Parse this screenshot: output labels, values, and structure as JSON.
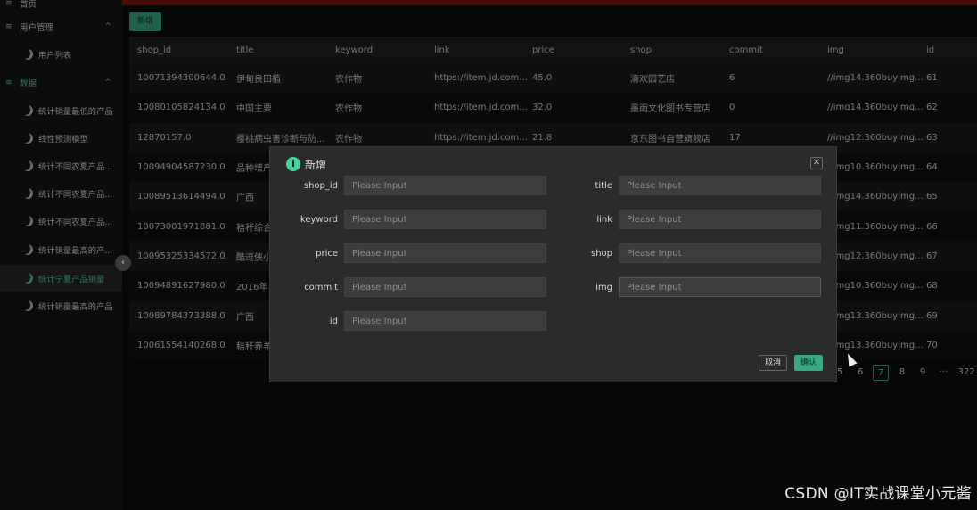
{
  "sidebar": {
    "top_partial_label": "首页",
    "groups": [
      {
        "label": "用户管理",
        "chevron": "^"
      },
      {
        "label": "数据",
        "chevron": "^"
      }
    ],
    "items": [
      {
        "label": "用户列表",
        "active": false
      },
      {
        "label": "统计销量最低的产品",
        "active": false
      },
      {
        "label": "线性预测模型",
        "active": false
      },
      {
        "label": "统计不同农夏产品...",
        "active": false
      },
      {
        "label": "统计不同农夏产品...",
        "active": false
      },
      {
        "label": "统计不同农夏产品...",
        "active": false
      },
      {
        "label": "统计销量最高的产...",
        "active": false
      },
      {
        "label": "统计宁夏产品销量",
        "active": true
      },
      {
        "label": "统计销量最高的产品",
        "active": false
      }
    ],
    "collapse_glyph": "‹"
  },
  "toolbar": {
    "add_label": "新增"
  },
  "table": {
    "columns": [
      "shop_id",
      "title",
      "keyword",
      "link",
      "price",
      "shop",
      "commit",
      "img",
      "id"
    ],
    "rows": [
      [
        "10071394300644.0",
        "伊甸良田植",
        "农作物",
        "https://item.jd.com...",
        "45.0",
        "清欢园艺店",
        "6",
        "//img14.360buyimg...",
        "61"
      ],
      [
        "10080105824134.0",
        "中国主要",
        "农作物",
        "https://item.jd.com...",
        "32.0",
        "墨雨文化图书专营店",
        "0",
        "//img14.360buyimg...",
        "62"
      ],
      [
        "12870157.0",
        "樱桃病虫害诊断与防...",
        "农作物",
        "https://item.jd.com...",
        "21.8",
        "京东图书自营旗舰店",
        "17",
        "//img12.360buyimg...",
        "63"
      ],
      [
        "10094904587230.0",
        "品种增产",
        "",
        "",
        "",
        "",
        "",
        "//img10.360buyimg...",
        "64"
      ],
      [
        "10089513614494.0",
        "广西",
        "",
        "",
        "",
        "",
        "",
        "//img14.360buyimg...",
        "65"
      ],
      [
        "10073001971881.0",
        "秸秆综合",
        "",
        "",
        "",
        "",
        "",
        "//img11.360buyimg...",
        "66"
      ],
      [
        "10095325334572.0",
        "酷逗侠小",
        "",
        "",
        "",
        "",
        "",
        "//img12.360buyimg...",
        "67"
      ],
      [
        "10094891627980.0",
        "2016年",
        "",
        "",
        "",
        "",
        "",
        "//img10.360buyimg...",
        "68"
      ],
      [
        "10089784373388.0",
        "广西",
        "",
        "",
        "",
        "",
        "",
        "//img13.360buyimg...",
        "69"
      ],
      [
        "10061554140268.0",
        "秸秆养羊",
        "",
        "",
        "",
        "",
        "",
        "//img13.360buyimg...",
        "70"
      ]
    ]
  },
  "pagination": {
    "pages": [
      "5",
      "6",
      "7",
      "8",
      "9",
      "···",
      "322"
    ],
    "current": "7"
  },
  "dialog": {
    "title": "新增",
    "info_glyph": "i",
    "close_glyph": "✕",
    "placeholder": "Please Input",
    "fields": [
      {
        "label": "shop_id"
      },
      {
        "label": "title"
      },
      {
        "label": "keyword"
      },
      {
        "label": "link"
      },
      {
        "label": "price"
      },
      {
        "label": "shop"
      },
      {
        "label": "commit"
      },
      {
        "label": "img"
      },
      {
        "label": "id"
      }
    ],
    "cancel_label": "取消",
    "ok_label": "确认"
  },
  "watermark": "CSDN @IT实战课堂小元酱",
  "colors": {
    "accent": "#3aa881",
    "accent_text": "#4fcf9b",
    "topbar": "#7a1515",
    "dialog_bg": "#2b2b2b"
  }
}
